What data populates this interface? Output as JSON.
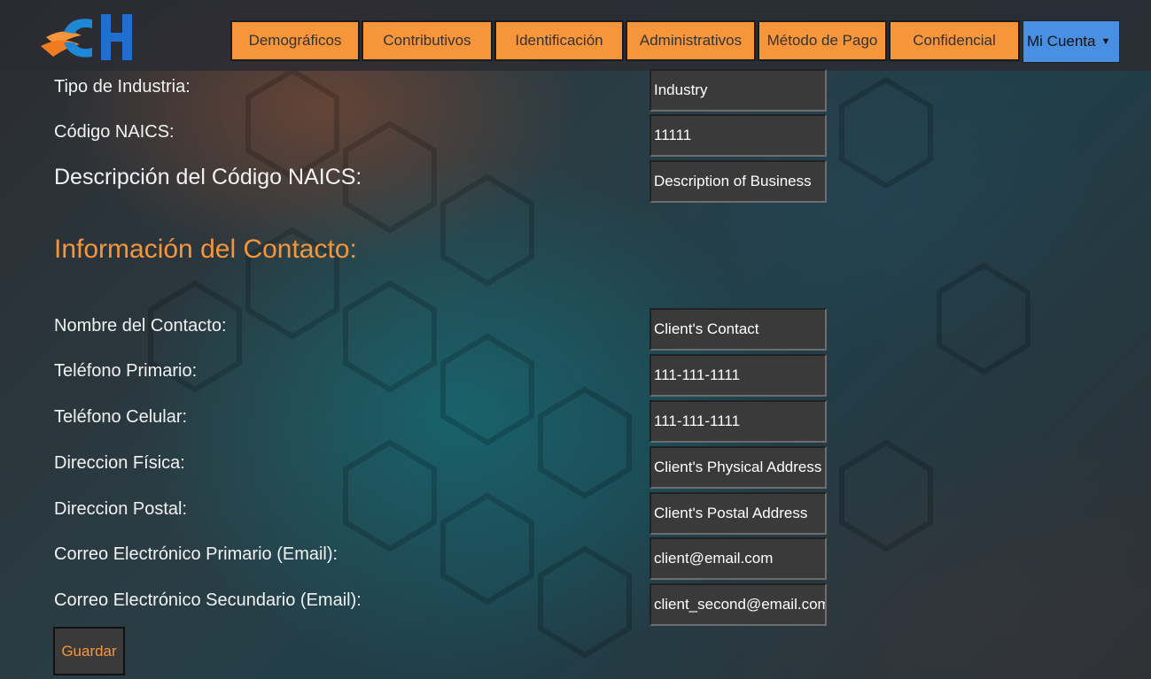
{
  "nav": {
    "items": [
      "Demográficos",
      "Contributivos",
      "Identificación",
      "Administrativos",
      "Método de Pago",
      "Confidencial"
    ],
    "account": "Mi Cuenta"
  },
  "business": {
    "industry_label": "Tipo de Industria:",
    "industry_value": "Industry",
    "naics_label": "Código NAICS:",
    "naics_value": "11111",
    "naics_desc_label": "Descripción del Código NAICS:",
    "naics_desc_value": "Description of Business"
  },
  "contact": {
    "heading": "Información del Contacto:",
    "name_label": "Nombre del Contacto:",
    "name_value": "Client's Contact",
    "phone_label": "Teléfono Primario:",
    "phone_value": "111-111-1111",
    "cell_label": "Teléfono Celular:",
    "cell_value": "111-111-1111",
    "physical_label": "Direccion Física:",
    "physical_value": "Client's Physical Address",
    "postal_label": "Direccion Postal:",
    "postal_value": "Client's Postal Address",
    "email1_label": "Correo Electrónico Primario (Email):",
    "email1_value": "client@email.com",
    "email2_label": "Correo Electrónico Secundario (Email):",
    "email2_value": "client_second@email.com"
  },
  "actions": {
    "save": "Guardar"
  },
  "colors": {
    "accent": "#f7953a",
    "account": "#4a90e2",
    "field_bg": "#3a3a3a"
  }
}
